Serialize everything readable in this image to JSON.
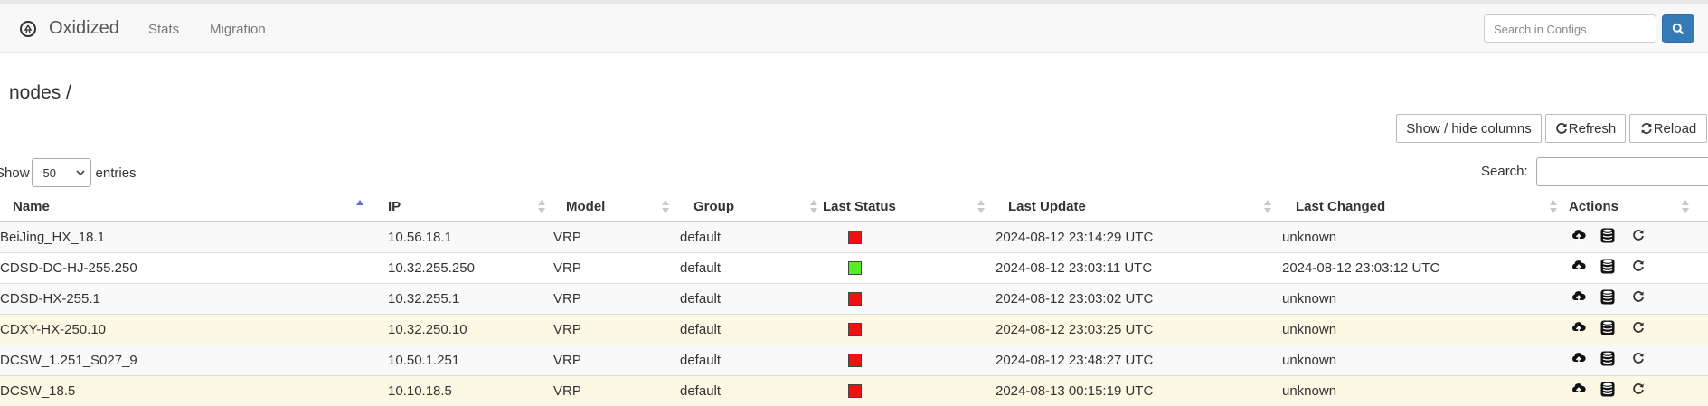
{
  "nav": {
    "brand": "Oxidized",
    "links": [
      "Stats",
      "Migration"
    ],
    "search_placeholder": "Search in Configs"
  },
  "page_title": "nodes /",
  "toolbar": {
    "columns_label": "Show / hide columns",
    "refresh_label": "Refresh",
    "reload_label": "Reload"
  },
  "length": {
    "prefix": "Show",
    "value": "50",
    "suffix": "entries"
  },
  "filter": {
    "label": "Search:"
  },
  "table": {
    "headers": [
      "Name",
      "IP",
      "Model",
      "Group",
      "Last Status",
      "Last Update",
      "Last Changed",
      "Actions"
    ],
    "rows": [
      {
        "name": "BeiJing_HX_18.1",
        "ip": "10.56.18.1",
        "model": "VRP",
        "group": "default",
        "status": "fail",
        "status_color": "#ee1111",
        "last_update": "2024-08-12 23:14:29 UTC",
        "last_changed": "unknown",
        "style": "odd"
      },
      {
        "name": "CDSD-DC-HJ-255.250",
        "ip": "10.32.255.250",
        "model": "VRP",
        "group": "default",
        "status": "success",
        "status_color": "#55ee22",
        "last_update": "2024-08-12 23:03:11 UTC",
        "last_changed": "2024-08-12 23:03:12 UTC",
        "style": "even"
      },
      {
        "name": "CDSD-HX-255.1",
        "ip": "10.32.255.1",
        "model": "VRP",
        "group": "default",
        "status": "fail",
        "status_color": "#ee1111",
        "last_update": "2024-08-12 23:03:02 UTC",
        "last_changed": "unknown",
        "style": "odd"
      },
      {
        "name": "CDXY-HX-250.10",
        "ip": "10.32.250.10",
        "model": "VRP",
        "group": "default",
        "status": "fail",
        "status_color": "#ee1111",
        "last_update": "2024-08-12 23:03:25 UTC",
        "last_changed": "unknown",
        "style": "warn"
      },
      {
        "name": "DCSW_1.251_S027_9",
        "ip": "10.50.1.251",
        "model": "VRP",
        "group": "default",
        "status": "fail",
        "status_color": "#ee1111",
        "last_update": "2024-08-12 23:48:27 UTC",
        "last_changed": "unknown",
        "style": "odd"
      },
      {
        "name": "DCSW_18.5",
        "ip": "10.10.18.5",
        "model": "VRP",
        "group": "default",
        "status": "fail",
        "status_color": "#ee1111",
        "last_update": "2024-08-13 00:15:19 UTC",
        "last_changed": "unknown",
        "style": "warn"
      }
    ]
  },
  "icons": {
    "brand": "oxidized-logo-icon",
    "search": "search-icon",
    "refresh": "refresh-icon",
    "reload": "reload-icon",
    "row_actions": [
      "cloud-upload-icon",
      "database-icon",
      "refresh-icon"
    ]
  },
  "colors": {
    "primary": "#337ab7",
    "fail": "#ee1111",
    "success": "#55ee22",
    "warning_row": "#fcf8e3"
  }
}
